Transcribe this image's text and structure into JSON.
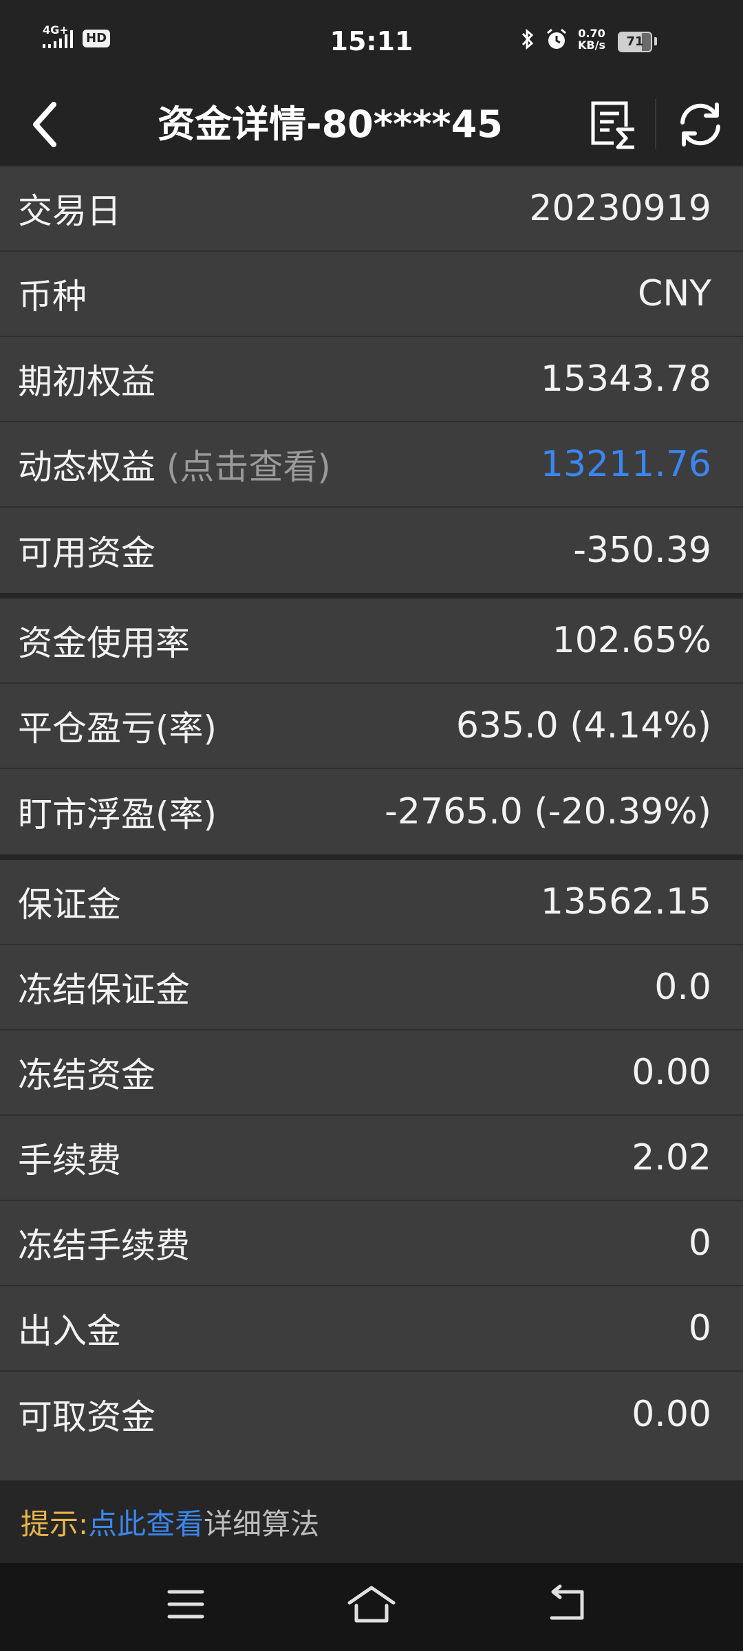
{
  "status_bar": {
    "signal_text": "4G+",
    "hd_badge": "HD",
    "time": "15:11",
    "net_speed_value": "0.70",
    "net_speed_unit": "KB/s",
    "battery_level": "71",
    "icons": [
      "signal-icon",
      "bluetooth-icon",
      "alarm-icon",
      "battery-icon"
    ]
  },
  "header": {
    "title": "资金详情-80****45",
    "icons": [
      "back-arrow-icon",
      "summary-sigma-icon",
      "refresh-icon"
    ]
  },
  "rows_section1": [
    {
      "label": "交易日",
      "hint": "",
      "value": "20230919"
    },
    {
      "label": "币种",
      "hint": "",
      "value": "CNY"
    },
    {
      "label": "期初权益",
      "hint": "",
      "value": "15343.78"
    },
    {
      "label": "动态权益 ",
      "hint": "(点击查看)",
      "value": "13211.76"
    },
    {
      "label": "可用资金",
      "hint": "",
      "value": "-350.39"
    }
  ],
  "rows_section2": [
    {
      "label": "资金使用率",
      "value": "102.65%"
    },
    {
      "label": "平仓盈亏(率)",
      "value": "635.0 (4.14%)"
    },
    {
      "label": "盯市浮盈(率)",
      "value": "-2765.0 (-20.39%)"
    }
  ],
  "rows_section3": [
    {
      "label": "保证金",
      "value": "13562.15"
    },
    {
      "label": "冻结保证金",
      "value": "0.0"
    },
    {
      "label": "冻结资金",
      "value": "0.00"
    },
    {
      "label": "手续费",
      "value": "2.02"
    },
    {
      "label": "冻结手续费",
      "value": "0"
    },
    {
      "label": "出入金",
      "value": "0"
    },
    {
      "label": "可取资金",
      "value": "0.00"
    }
  ],
  "tip": {
    "label": "提示:",
    "link": "点此查看",
    "rest": "详细算法"
  },
  "colors": {
    "link_blue": "#3b86f0",
    "tip_orange": "#e8b54a",
    "row_bg": "#3d3d3d",
    "header_bg": "#232323"
  },
  "nav_bar": {
    "icons": [
      "menu-icon",
      "home-icon",
      "back-icon"
    ]
  }
}
